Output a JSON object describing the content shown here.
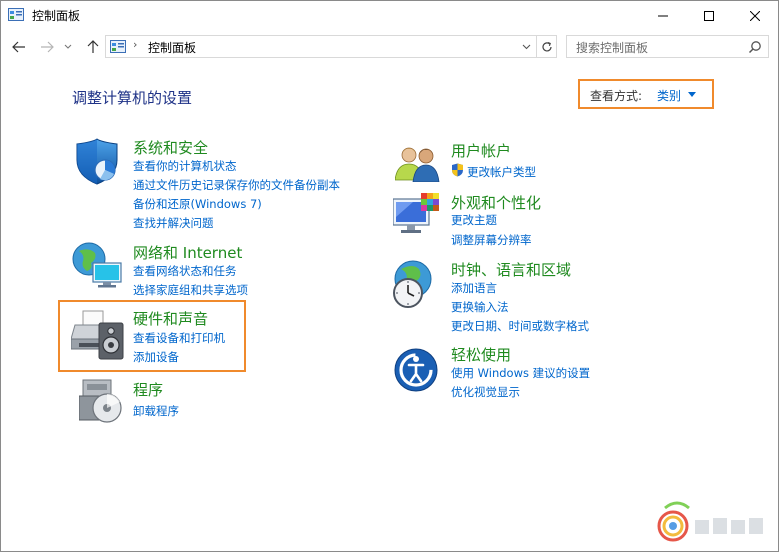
{
  "window": {
    "title": "控制面板"
  },
  "nav": {
    "address_path": "控制面板",
    "address_sep": "›",
    "search_placeholder": "搜索控制面板"
  },
  "content": {
    "page_title": "调整计算机的设置",
    "view_by_label": "查看方式:",
    "view_by_value": "类别"
  },
  "categories": {
    "system": {
      "title": "系统和安全",
      "links": [
        "查看你的计算机状态",
        "通过文件历史记录保存你的文件备份副本",
        "备份和还原(Windows 7)",
        "查找并解决问题"
      ]
    },
    "network": {
      "title": "网络和 Internet",
      "links": [
        "查看网络状态和任务",
        "选择家庭组和共享选项"
      ]
    },
    "hardware": {
      "title": "硬件和声音",
      "links": [
        "查看设备和打印机",
        "添加设备"
      ]
    },
    "programs": {
      "title": "程序",
      "links": [
        "卸载程序"
      ]
    },
    "users": {
      "title": "用户帐户",
      "links": [
        "更改帐户类型"
      ]
    },
    "appearance": {
      "title": "外观和个性化",
      "links": [
        "更改主题",
        "调整屏幕分辨率"
      ]
    },
    "clock": {
      "title": "时钟、语言和区域",
      "links": [
        "添加语言",
        "更换输入法",
        "更改日期、时间或数字格式"
      ]
    },
    "ease": {
      "title": "轻松使用",
      "links": [
        "使用 Windows 建议的设置",
        "优化视觉显示"
      ]
    }
  },
  "colors": {
    "category_title": "#1f8a1f",
    "link": "#0066cc",
    "page_title": "#1e3287",
    "highlight": "#f08a2c"
  },
  "icons": {
    "title": "control-panel-icon",
    "system": "shield-icon",
    "network": "globe-monitor-icon",
    "hardware": "printer-speaker-icon",
    "programs": "programs-disc-icon",
    "users": "users-icon",
    "appearance": "display-palette-icon",
    "clock": "globe-clock-icon",
    "ease": "ease-of-access-icon"
  }
}
